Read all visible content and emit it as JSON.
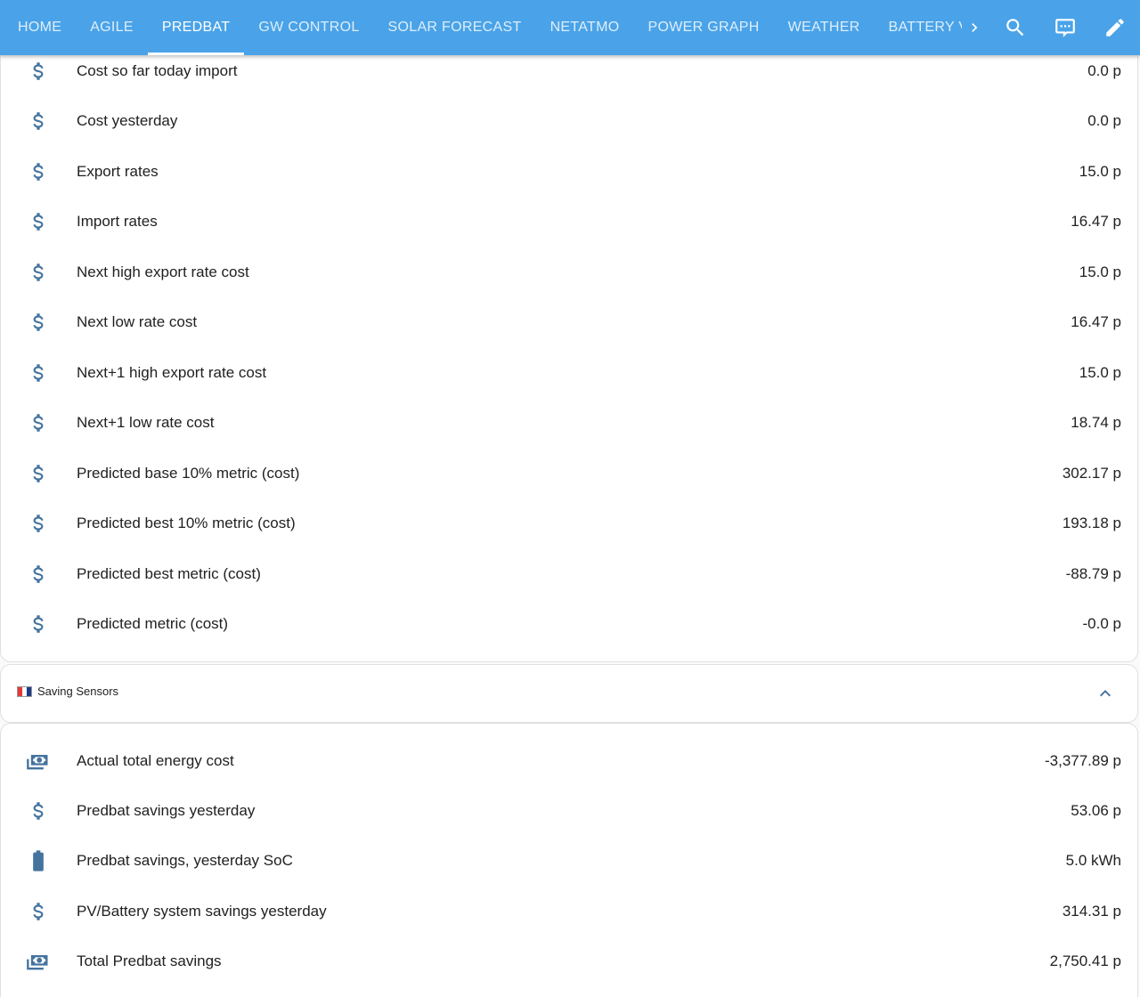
{
  "tabs": [
    {
      "label": "Home"
    },
    {
      "label": "Agile"
    },
    {
      "label": "Predbat",
      "active": true
    },
    {
      "label": "GW Control"
    },
    {
      "label": "Solar Forecast"
    },
    {
      "label": "Netatmo"
    },
    {
      "label": "Power Graph"
    },
    {
      "label": "Weather"
    },
    {
      "label": "Battery Voltag"
    }
  ],
  "toolbar_icons": [
    "search-icon",
    "chat-icon",
    "pencil-icon"
  ],
  "colors": {
    "header": "#4aa3e8",
    "icon": "#44739e"
  },
  "cost_rows": [
    {
      "icon": "currency-usd-icon",
      "label": "Cost so far today import",
      "value": "0.0 p"
    },
    {
      "icon": "currency-usd-icon",
      "label": "Cost yesterday",
      "value": "0.0 p"
    },
    {
      "icon": "currency-usd-icon",
      "label": "Export rates",
      "value": "15.0 p"
    },
    {
      "icon": "currency-usd-icon",
      "label": "Import rates",
      "value": "16.47 p"
    },
    {
      "icon": "currency-usd-icon",
      "label": "Next high export rate cost",
      "value": "15.0 p"
    },
    {
      "icon": "currency-usd-icon",
      "label": "Next low rate cost",
      "value": "16.47 p"
    },
    {
      "icon": "currency-usd-icon",
      "label": "Next+1 high export rate cost",
      "value": "15.0 p"
    },
    {
      "icon": "currency-usd-icon",
      "label": "Next+1 low rate cost",
      "value": "18.74 p"
    },
    {
      "icon": "currency-usd-icon",
      "label": "Predicted base 10% metric (cost)",
      "value": "302.17 p"
    },
    {
      "icon": "currency-usd-icon",
      "label": "Predicted best 10% metric (cost)",
      "value": "193.18 p"
    },
    {
      "icon": "currency-usd-icon",
      "label": "Predicted best metric (cost)",
      "value": "-88.79 p"
    },
    {
      "icon": "currency-usd-icon",
      "label": "Predicted metric (cost)",
      "value": "-0.0 p"
    }
  ],
  "saving_section": {
    "title": "Saving Sensors",
    "rows": [
      {
        "icon": "cash-multiple-icon",
        "label": "Actual total energy cost",
        "value": "-3,377.89 p"
      },
      {
        "icon": "currency-usd-icon",
        "label": "Predbat savings yesterday",
        "value": "53.06 p"
      },
      {
        "icon": "battery-icon",
        "label": "Predbat savings, yesterday SoC",
        "value": "5.0 kWh"
      },
      {
        "icon": "currency-usd-icon",
        "label": "PV/Battery system savings yesterday",
        "value": "314.31 p"
      },
      {
        "icon": "cash-multiple-icon",
        "label": "Total Predbat savings",
        "value": "2,750.41 p"
      }
    ]
  }
}
